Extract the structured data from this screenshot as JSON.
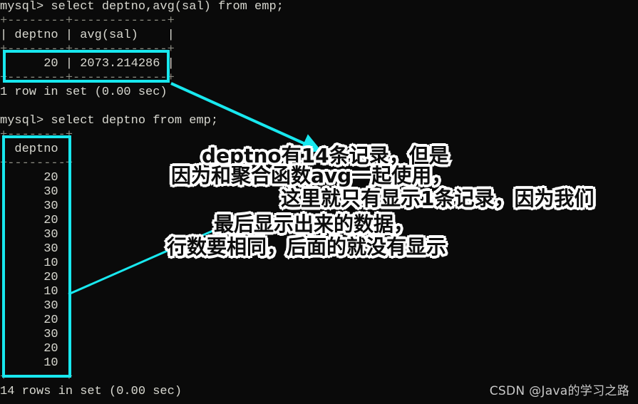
{
  "terminal": {
    "prompt_symbol": "mysql>",
    "lines": [
      {
        "text": "mysql> select deptno,avg(sal) from emp;",
        "kind": "command"
      },
      {
        "text": "+--------+-------------+",
        "kind": "rule"
      },
      {
        "text": "| deptno | avg(sal)    |",
        "kind": "header"
      },
      {
        "text": "+--------+-------------+",
        "kind": "rule"
      },
      {
        "text": "|     20 | 2073.214286 |",
        "kind": "row"
      },
      {
        "text": "+--------+-------------+",
        "kind": "rule"
      },
      {
        "text": "1 row in set (0.00 sec)",
        "kind": "status"
      },
      {
        "text": "",
        "kind": "blank"
      },
      {
        "text": "mysql> select deptno from emp;",
        "kind": "command"
      },
      {
        "text": "+--------+",
        "kind": "rule"
      },
      {
        "text": "| deptno |",
        "kind": "header"
      },
      {
        "text": "+--------+",
        "kind": "rule"
      },
      {
        "text": "|     20 |",
        "kind": "row"
      },
      {
        "text": "|     30 |",
        "kind": "row"
      },
      {
        "text": "|     30 |",
        "kind": "row"
      },
      {
        "text": "|     20 |",
        "kind": "row"
      },
      {
        "text": "|     30 |",
        "kind": "row"
      },
      {
        "text": "|     30 |",
        "kind": "row"
      },
      {
        "text": "|     10 |",
        "kind": "row"
      },
      {
        "text": "|     20 |",
        "kind": "row"
      },
      {
        "text": "|     10 |",
        "kind": "row"
      },
      {
        "text": "|     30 |",
        "kind": "row"
      },
      {
        "text": "|     20 |",
        "kind": "row"
      },
      {
        "text": "|     30 |",
        "kind": "row"
      },
      {
        "text": "|     20 |",
        "kind": "row"
      },
      {
        "text": "|     10 |",
        "kind": "row"
      },
      {
        "text": "+--------+",
        "kind": "rule"
      },
      {
        "text": "14 rows in set (0.00 sec)",
        "kind": "status"
      }
    ],
    "query_1": {
      "sql": "select deptno,avg(sal) from emp;",
      "columns": [
        "deptno",
        "avg(sal)"
      ],
      "rows": [
        [
          "20",
          "2073.214286"
        ]
      ],
      "status": "1 row in set (0.00 sec)"
    },
    "query_2": {
      "sql": "select deptno from emp;",
      "columns": [
        "deptno"
      ],
      "rows": [
        "20",
        "30",
        "30",
        "20",
        "30",
        "30",
        "10",
        "20",
        "10",
        "30",
        "20",
        "30",
        "20",
        "10"
      ],
      "status": "14 rows in set (0.00 sec)"
    }
  },
  "annotations": {
    "color": "#18e8ef",
    "lines": [
      "deptno有14条记录，但是",
      "因为和聚合函数avg一起使用，",
      "这里就只有显示1条记录，因为我们",
      "最后显示出来的数据，",
      "行数要相同，后面的就没有显示"
    ],
    "highlight_boxes": [
      {
        "label": "avg-result-row"
      },
      {
        "label": "deptno-column"
      }
    ]
  },
  "watermark": {
    "text": "CSDN @Java的学习之路"
  }
}
